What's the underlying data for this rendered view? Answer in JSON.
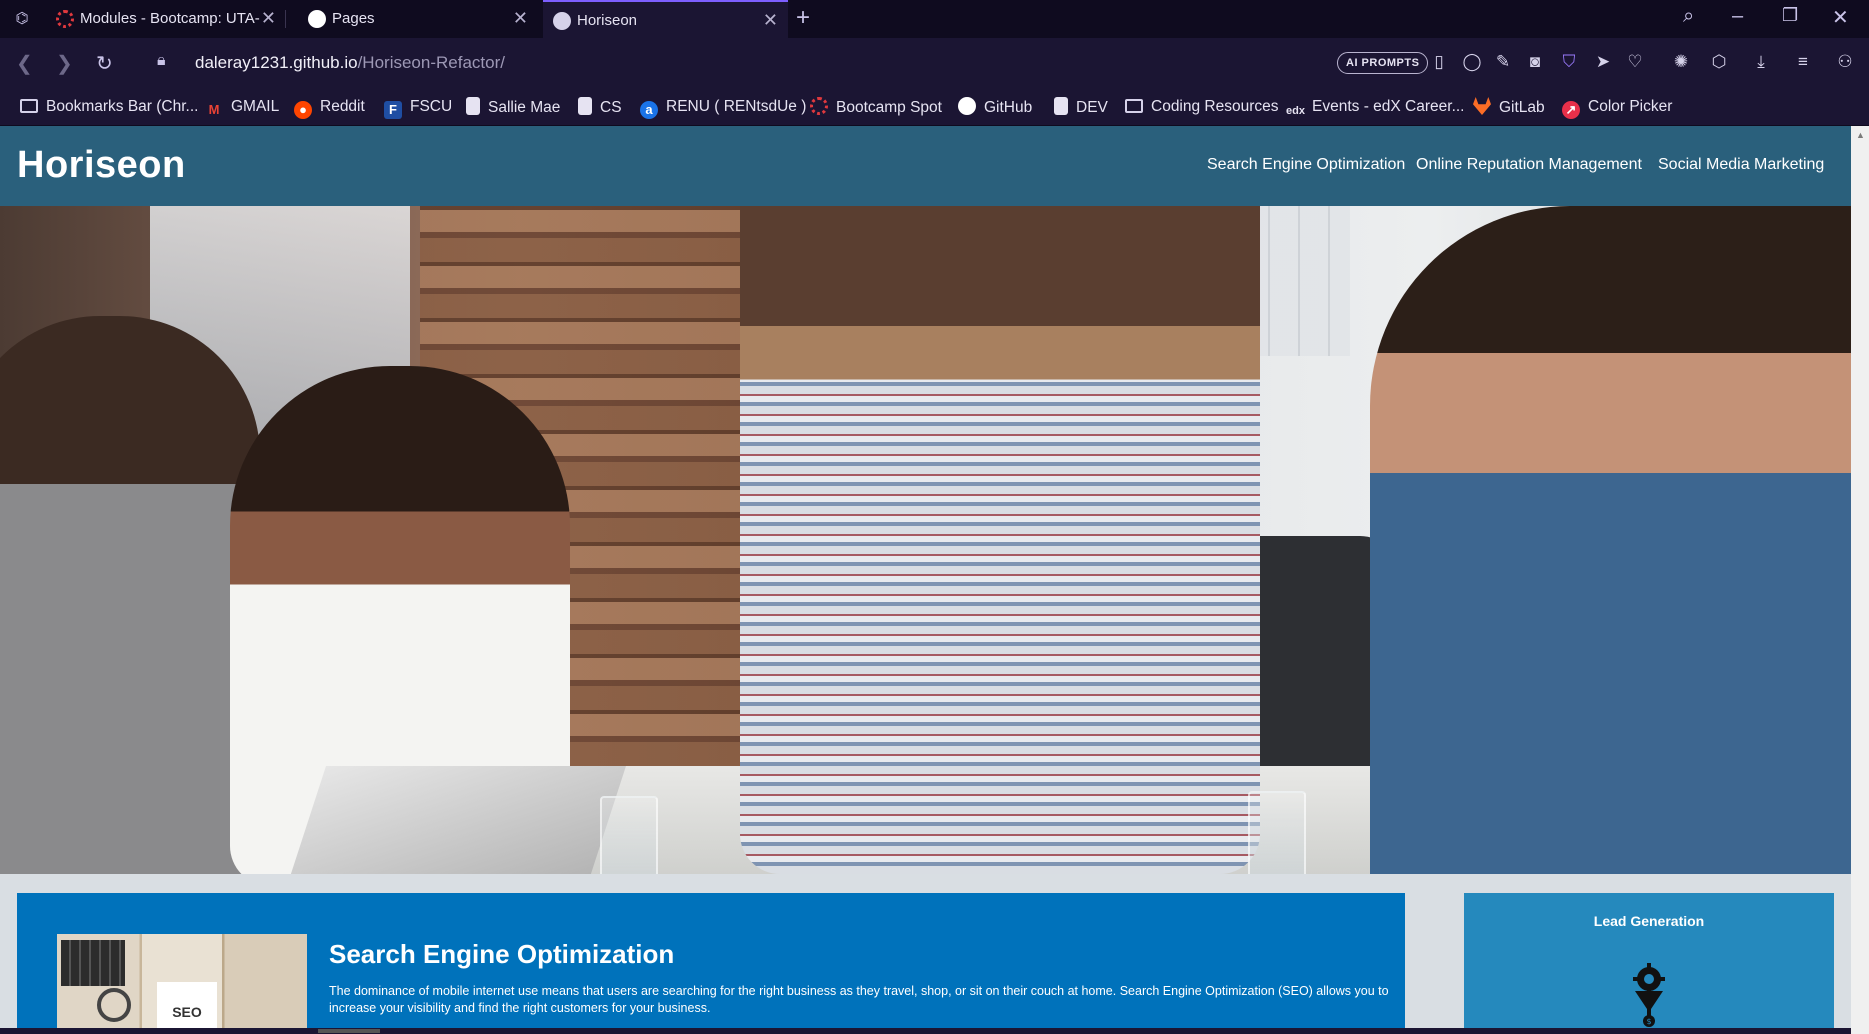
{
  "browser": {
    "tabs": [
      {
        "title": "Modules - Bootcamp: UTA-",
        "active": false
      },
      {
        "title": "Pages",
        "active": false
      },
      {
        "title": "Horiseon",
        "active": true
      }
    ],
    "url_host": "daleray1231.github.io",
    "url_path": "/Horiseon-Refactor/",
    "ai_prompts_label": "AI PROMPTS",
    "accent_color": "#7d5fff"
  },
  "bookmarks": [
    {
      "label": "Bookmarks Bar (Chr...",
      "icon": "folder-icon"
    },
    {
      "label": "GMAIL",
      "icon": "gmail-icon"
    },
    {
      "label": "Reddit",
      "icon": "reddit-icon"
    },
    {
      "label": "FSCU",
      "icon": "fscu-icon"
    },
    {
      "label": "Sallie Mae",
      "icon": "page-icon"
    },
    {
      "label": "CS",
      "icon": "page-icon"
    },
    {
      "label": "RENU ( RENtsdUe )",
      "icon": "renu-icon"
    },
    {
      "label": "Bootcamp Spot",
      "icon": "bootcamp-icon"
    },
    {
      "label": "GitHub",
      "icon": "github-icon"
    },
    {
      "label": "DEV",
      "icon": "page-icon"
    },
    {
      "label": "Coding Resources",
      "icon": "folder-icon"
    },
    {
      "label": "Events - edX Career...",
      "icon": "edx-icon"
    },
    {
      "label": "GitLab",
      "icon": "gitlab-icon"
    },
    {
      "label": "Color Picker",
      "icon": "color-picker-icon"
    }
  ],
  "site": {
    "logo": "Horiseon",
    "nav": [
      "Search Engine Optimization",
      "Online Reputation Management",
      "Social Media Marketing"
    ],
    "header_color": "#2a607c",
    "seo": {
      "title": "Search Engine Optimization",
      "text": "The dominance of mobile internet use means that users are searching for the right business as they travel, shop, or sit on their couch at home. Search Engine Optimization (SEO) allows you to increase your visibility and find the right customers for your business.",
      "image_caption": "SEO",
      "color": "#0072bb"
    },
    "lead": {
      "title": "Lead Generation",
      "color": "#2589bd"
    }
  }
}
